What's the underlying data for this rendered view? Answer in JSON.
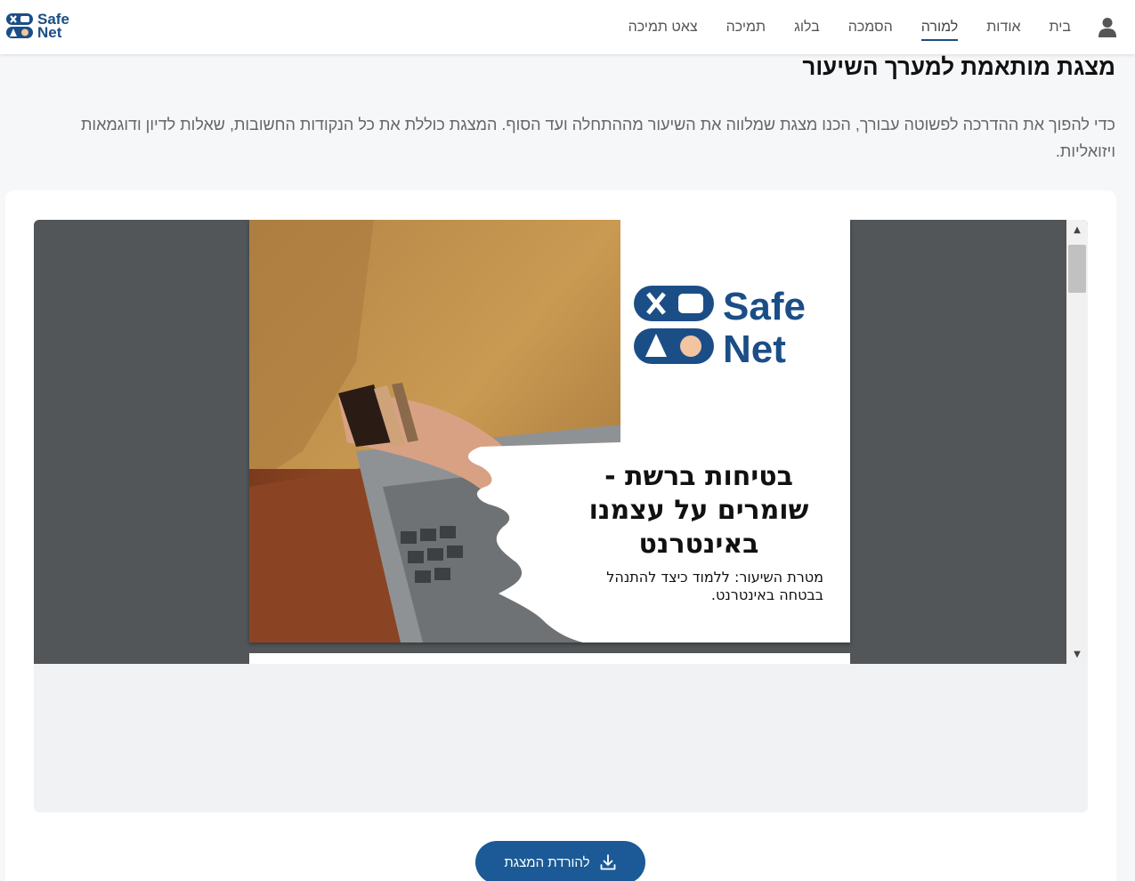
{
  "header": {
    "logo_text_line1": "Safe",
    "logo_text_line2": "Net",
    "nav": [
      {
        "label": "בית"
      },
      {
        "label": "אודות"
      },
      {
        "label": "למורה"
      },
      {
        "label": "הסמכה"
      },
      {
        "label": "בלוג"
      },
      {
        "label": "תמיכה"
      },
      {
        "label": "צאט תמיכה"
      }
    ],
    "active_index": 2
  },
  "main": {
    "title": "מצגת מותאמת למערך השיעור",
    "description": "כדי להפוך את ההדרכה לפשוטה עבורך, הכנו מצגת שמלווה את השיעור מההתחלה ועד הסוף. המצגת כוללת את כל הנקודות החשובות, שאלות לדיון ודוגמאות ויזואליות."
  },
  "slide": {
    "logo_line1": "Safe",
    "logo_line2": "Net",
    "title": "בטיחות ברשת  - שומרים על עצמנו באינטרנט",
    "subtitle": "מטרת השיעור: ללמוד כיצד להתנהל בבטחה באינטרנט."
  },
  "download_button": {
    "label": "להורדת המצגת",
    "icon": "download-icon"
  },
  "colors": {
    "brand": "#1b4e86",
    "button": "#1b5a96",
    "viewer_bg": "#525659",
    "accent_peach": "#f2c4a0"
  }
}
